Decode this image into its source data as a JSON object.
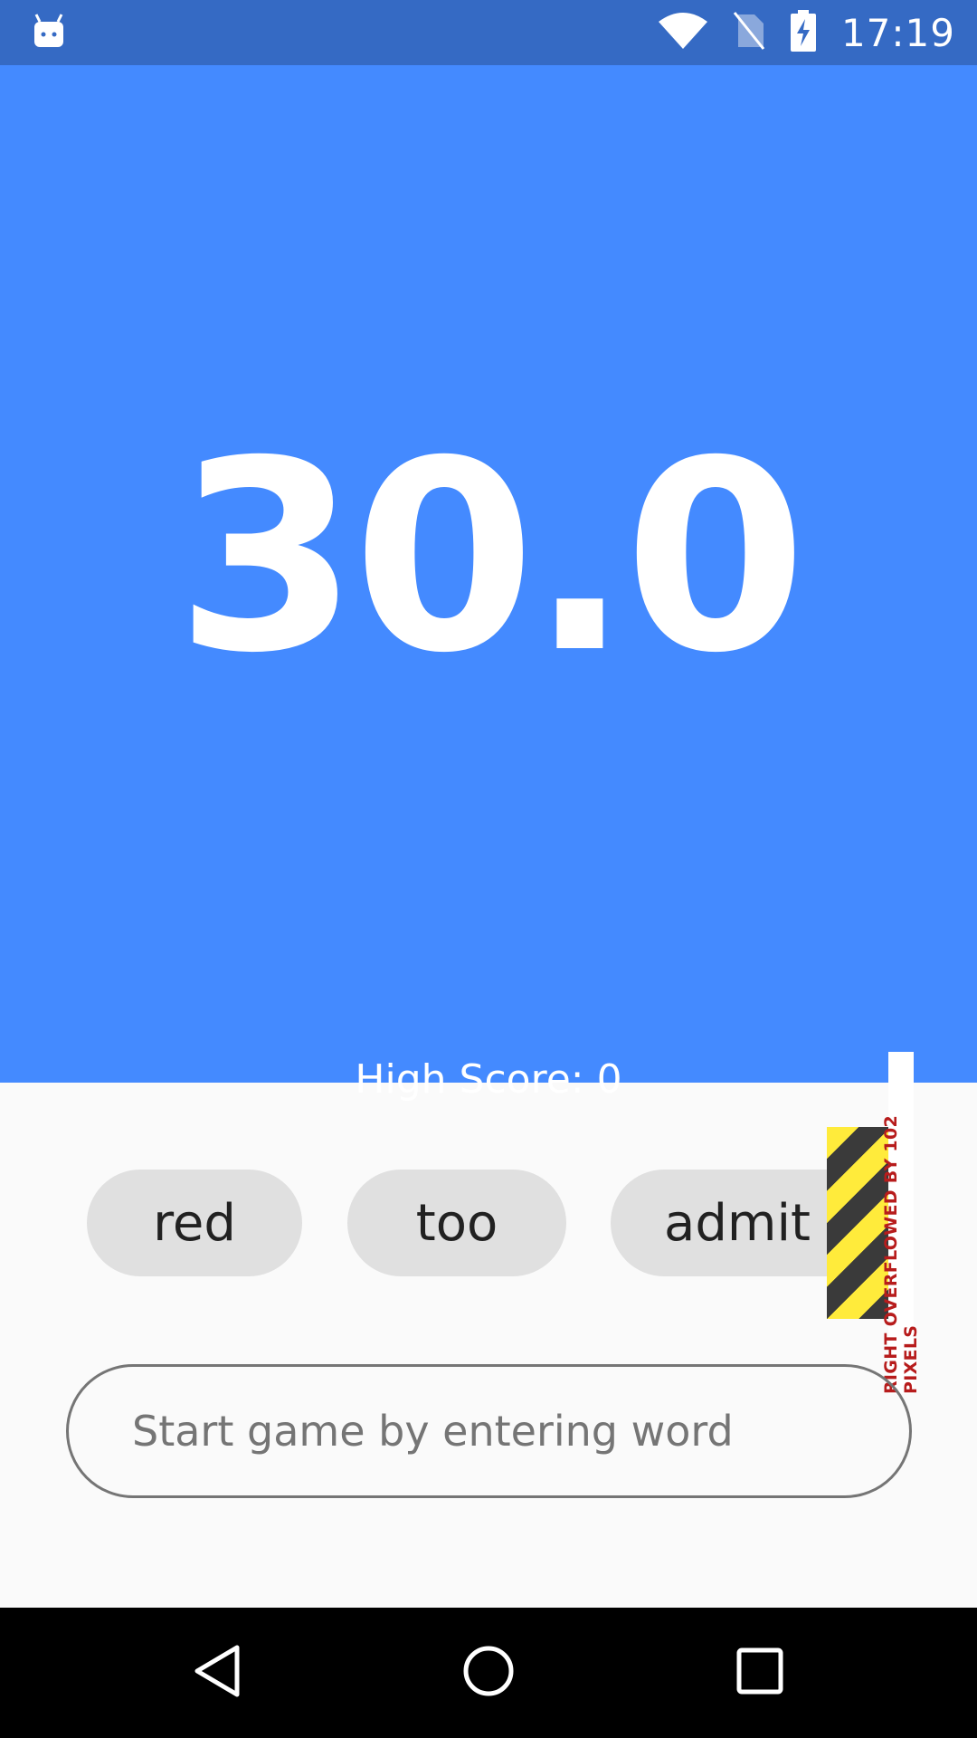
{
  "status_bar": {
    "time": "17:19",
    "icons": [
      "android-debug-icon",
      "wifi-icon",
      "no-sim-icon",
      "battery-charging-icon"
    ]
  },
  "game": {
    "timer": "30.0",
    "high_score": "High Score: 0",
    "background_color": "#448aff"
  },
  "words": [
    {
      "label": "red"
    },
    {
      "label": "too"
    },
    {
      "label": "admit"
    }
  ],
  "overflow_warning": "RIGHT OVERFLOWED BY 102 PIXELS",
  "input": {
    "placeholder": "Start game by entering word"
  },
  "nav_bar": {
    "icons": [
      "back-icon",
      "home-icon",
      "recents-icon"
    ]
  }
}
